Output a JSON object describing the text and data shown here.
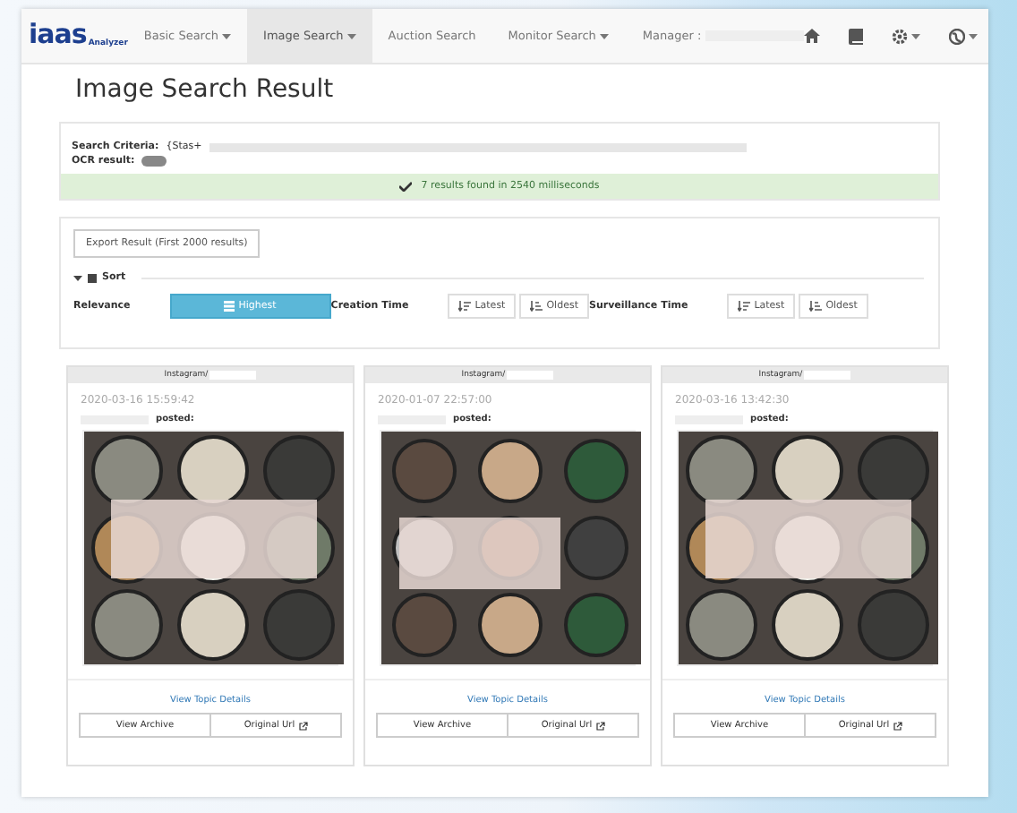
{
  "nav": {
    "logo": "iaas",
    "logo_sub": "Analyzer",
    "items": [
      {
        "label": "Basic Search",
        "dropdown": true,
        "selected": false
      },
      {
        "label": "Image Search",
        "dropdown": true,
        "selected": true
      },
      {
        "label": "Auction Search",
        "dropdown": false,
        "selected": false
      },
      {
        "label": "Monitor Search",
        "dropdown": true,
        "selected": false
      }
    ],
    "manager_label": "Manager :",
    "icon_buttons": [
      {
        "kind": "home",
        "dropdown": false
      },
      {
        "kind": "book",
        "dropdown": false
      },
      {
        "kind": "settings",
        "dropdown": true
      },
      {
        "kind": "globe",
        "dropdown": true
      }
    ]
  },
  "page_title": "Image Search Result",
  "criteria": {
    "label": "Search Criteria:",
    "value": "{Stas+",
    "ocr_label": "OCR result:",
    "status": "7 results found in 2540 milliseconds"
  },
  "sort_panel": {
    "export_button": "Export Result (First 2000 results)",
    "sort_label": "Sort",
    "expanded": true,
    "groups": [
      {
        "label": "Relevance",
        "options": [
          {
            "label": "Highest",
            "kind": "list",
            "selected": true
          }
        ]
      },
      {
        "label": "Creation Time",
        "options": [
          {
            "label": "Latest",
            "kind": "sort-desc",
            "selected": false
          },
          {
            "label": "Oldest",
            "kind": "sort-asc",
            "selected": false
          }
        ]
      },
      {
        "label": "Surveillance Time",
        "options": [
          {
            "label": "Latest",
            "kind": "sort-desc",
            "selected": false
          },
          {
            "label": "Oldest",
            "kind": "sort-asc",
            "selected": false
          }
        ]
      }
    ]
  },
  "cards": [
    {
      "source": "Instagram/",
      "date": "2020-03-16 15:59:42",
      "posted": "posted:",
      "picture": {
        "kind": "picture"
      },
      "details_link": "View Topic Details",
      "buttons": [
        "View Archive",
        "Original Url"
      ]
    },
    {
      "source": "Instagram/",
      "date": "2020-01-07 22:57:00",
      "posted": "posted:",
      "picture": {
        "kind": "picture"
      },
      "details_link": "View Topic Details",
      "buttons": [
        "View Archive",
        "Original Url"
      ]
    },
    {
      "source": "Instagram/",
      "date": "2020-03-16 13:42:30",
      "posted": "posted:",
      "picture": {
        "kind": "picture"
      },
      "details_link": "View Topic Details",
      "buttons": [
        "View Archive",
        "Original Url"
      ]
    }
  ]
}
